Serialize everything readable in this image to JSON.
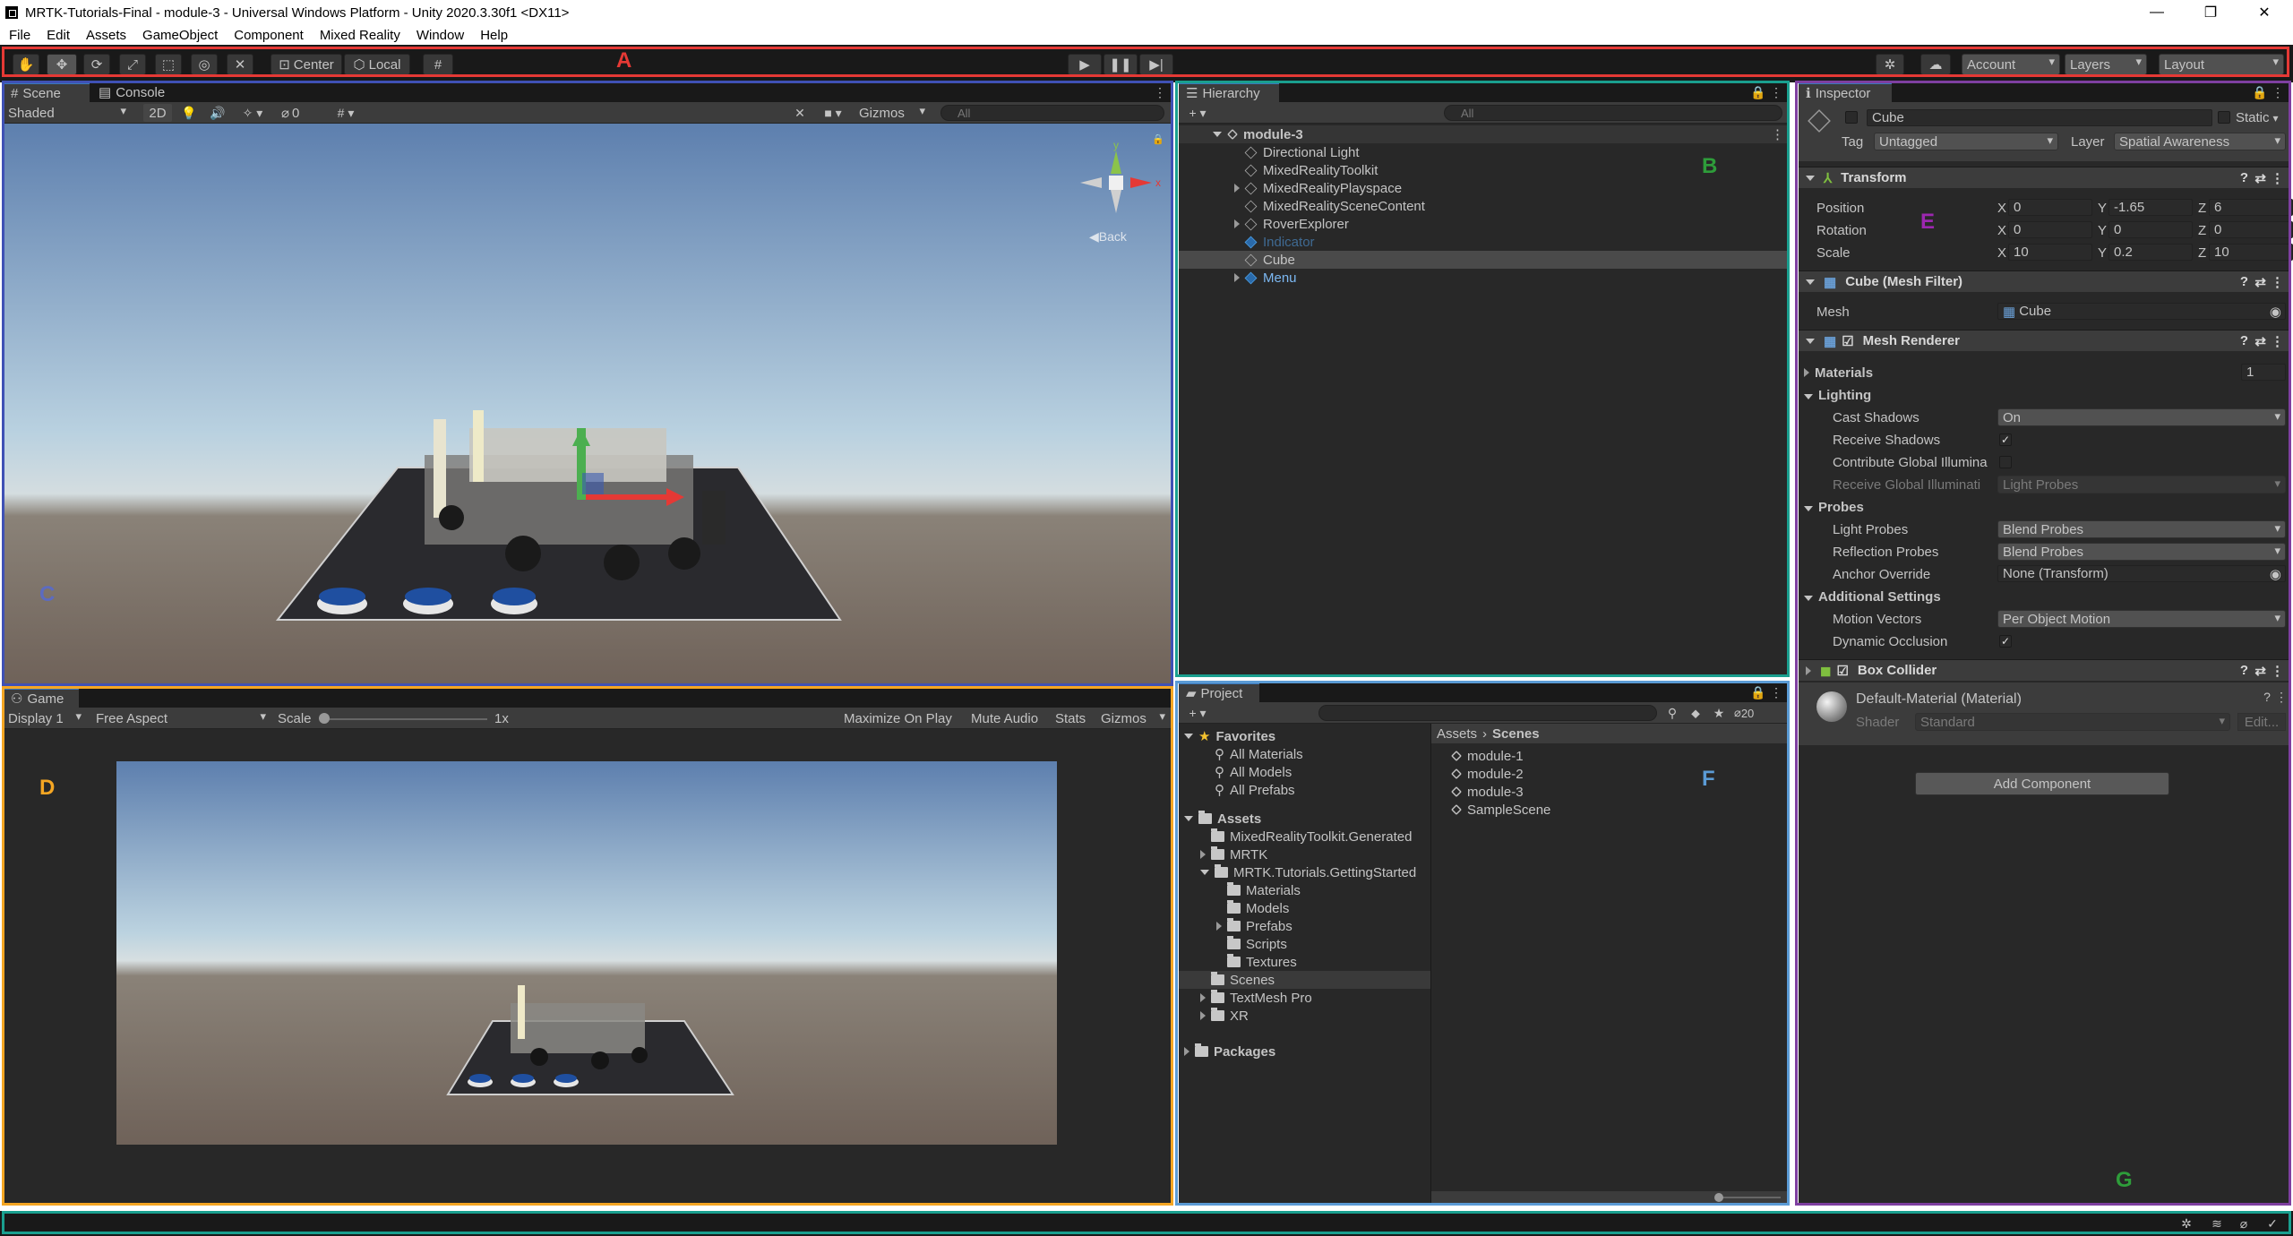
{
  "window": {
    "title": "MRTK-Tutorials-Final - module-3 - Universal Windows Platform - Unity 2020.3.30f1 <DX11>",
    "minimize": "—",
    "maximize": "❐",
    "close": "✕"
  },
  "menu": [
    "File",
    "Edit",
    "Assets",
    "GameObject",
    "Component",
    "Mixed Reality",
    "Window",
    "Help"
  ],
  "toolbar": {
    "tools": [
      "hand-icon",
      "move-icon",
      "rotate-icon",
      "scale-icon",
      "rect-icon",
      "transform-icon",
      "custom-tool-icon"
    ],
    "pivot": "Center",
    "space": "Local",
    "account": "Account",
    "layers": "Layers",
    "layout": "Layout"
  },
  "scene": {
    "tabs": [
      "Scene",
      "Console"
    ],
    "shading": "Shaded",
    "mode2d": "2D",
    "hidden_count": "0",
    "gizmos": "Gizmos",
    "search_placeholder": "All",
    "back_label": "Back"
  },
  "game": {
    "tab": "Game",
    "display": "Display 1",
    "aspect": "Free Aspect",
    "scale_label": "Scale",
    "scale_value": "1x",
    "scale_level": 0,
    "maximize": "Maximize On Play",
    "mute": "Mute Audio",
    "stats": "Stats",
    "gizmos": "Gizmos"
  },
  "hierarchy": {
    "tab": "Hierarchy",
    "search_placeholder": "All",
    "scene": "module-3",
    "items": [
      {
        "label": "Directional Light",
        "expandable": false,
        "kind": "gray"
      },
      {
        "label": "MixedRealityToolkit",
        "expandable": false,
        "kind": "gray"
      },
      {
        "label": "MixedRealityPlayspace",
        "expandable": true,
        "kind": "gray"
      },
      {
        "label": "MixedRealitySceneContent",
        "expandable": false,
        "kind": "gray"
      },
      {
        "label": "RoverExplorer",
        "expandable": true,
        "kind": "gray"
      },
      {
        "label": "Indicator",
        "expandable": false,
        "kind": "prefab-disabled"
      },
      {
        "label": "Cube",
        "expandable": false,
        "kind": "selected"
      },
      {
        "label": "Menu",
        "expandable": true,
        "kind": "prefab"
      }
    ]
  },
  "project": {
    "tab": "Project",
    "hidden_count": "20",
    "favorites": "Favorites",
    "favorite_items": [
      "All Materials",
      "All Models",
      "All Prefabs"
    ],
    "assets": "Assets",
    "tree": [
      {
        "label": "MixedRealityToolkit.Generated",
        "indent": 1,
        "arrow": "none"
      },
      {
        "label": "MRTK",
        "indent": 1,
        "arrow": "right"
      },
      {
        "label": "MRTK.Tutorials.GettingStarted",
        "indent": 1,
        "arrow": "down"
      },
      {
        "label": "Materials",
        "indent": 2,
        "arrow": "none"
      },
      {
        "label": "Models",
        "indent": 2,
        "arrow": "none"
      },
      {
        "label": "Prefabs",
        "indent": 2,
        "arrow": "right"
      },
      {
        "label": "Scripts",
        "indent": 2,
        "arrow": "none"
      },
      {
        "label": "Textures",
        "indent": 2,
        "arrow": "none"
      },
      {
        "label": "Scenes",
        "indent": 1,
        "arrow": "none"
      },
      {
        "label": "TextMesh Pro",
        "indent": 1,
        "arrow": "right"
      },
      {
        "label": "XR",
        "indent": 1,
        "arrow": "right"
      }
    ],
    "packages": "Packages",
    "breadcrumb": [
      "Assets",
      "Scenes"
    ],
    "files": [
      "module-1",
      "module-2",
      "module-3",
      "SampleScene"
    ]
  },
  "inspector": {
    "tab": "Inspector",
    "object_name": "Cube",
    "static": "Static",
    "tag_label": "Tag",
    "tag": "Untagged",
    "layer_label": "Layer",
    "layer": "Spatial Awareness",
    "transform": {
      "title": "Transform",
      "position_label": "Position",
      "rotation_label": "Rotation",
      "scale_label": "Scale",
      "position": [
        "0",
        "-1.65",
        "6"
      ],
      "rotation": [
        "0",
        "0",
        "0"
      ],
      "scale": [
        "10",
        "0.2",
        "10"
      ]
    },
    "mesh_filter": {
      "title": "Cube (Mesh Filter)",
      "mesh_label": "Mesh",
      "mesh": "Cube"
    },
    "mesh_renderer": {
      "title": "Mesh Renderer",
      "materials": "Materials",
      "materials_count": "1",
      "lighting": "Lighting",
      "cast_shadows_label": "Cast Shadows",
      "cast_shadows": "On",
      "receive_shadows_label": "Receive Shadows",
      "contribute_gi_label": "Contribute Global Illumina",
      "receive_gi_label": "Receive Global Illuminati",
      "receive_gi": "Light Probes",
      "probes": "Probes",
      "light_probes_label": "Light Probes",
      "light_probes": "Blend Probes",
      "reflection_probes_label": "Reflection Probes",
      "reflection_probes": "Blend Probes",
      "anchor_label": "Anchor Override",
      "anchor": "None (Transform)",
      "additional": "Additional Settings",
      "motion_vectors_label": "Motion Vectors",
      "motion_vectors": "Per Object Motion",
      "dynamic_occlusion_label": "Dynamic Occlusion"
    },
    "box_collider": {
      "title": "Box Collider"
    },
    "material": {
      "name": "Default-Material (Material)",
      "shader_label": "Shader",
      "shader": "Standard",
      "edit": "Edit..."
    },
    "add_component": "Add Component"
  },
  "annotations": {
    "A": "A",
    "B": "B",
    "C": "C",
    "D": "D",
    "E": "E",
    "F": "F",
    "G": "G"
  },
  "colors": {
    "red": "#e53935",
    "blue": "#3f51b5",
    "teal": "#1a9f8f",
    "orange": "#f5a623",
    "light_blue": "#5b9bd5",
    "purple": "#7e3fa0",
    "green": "#2e7d32",
    "selection": "#3a79bb"
  }
}
